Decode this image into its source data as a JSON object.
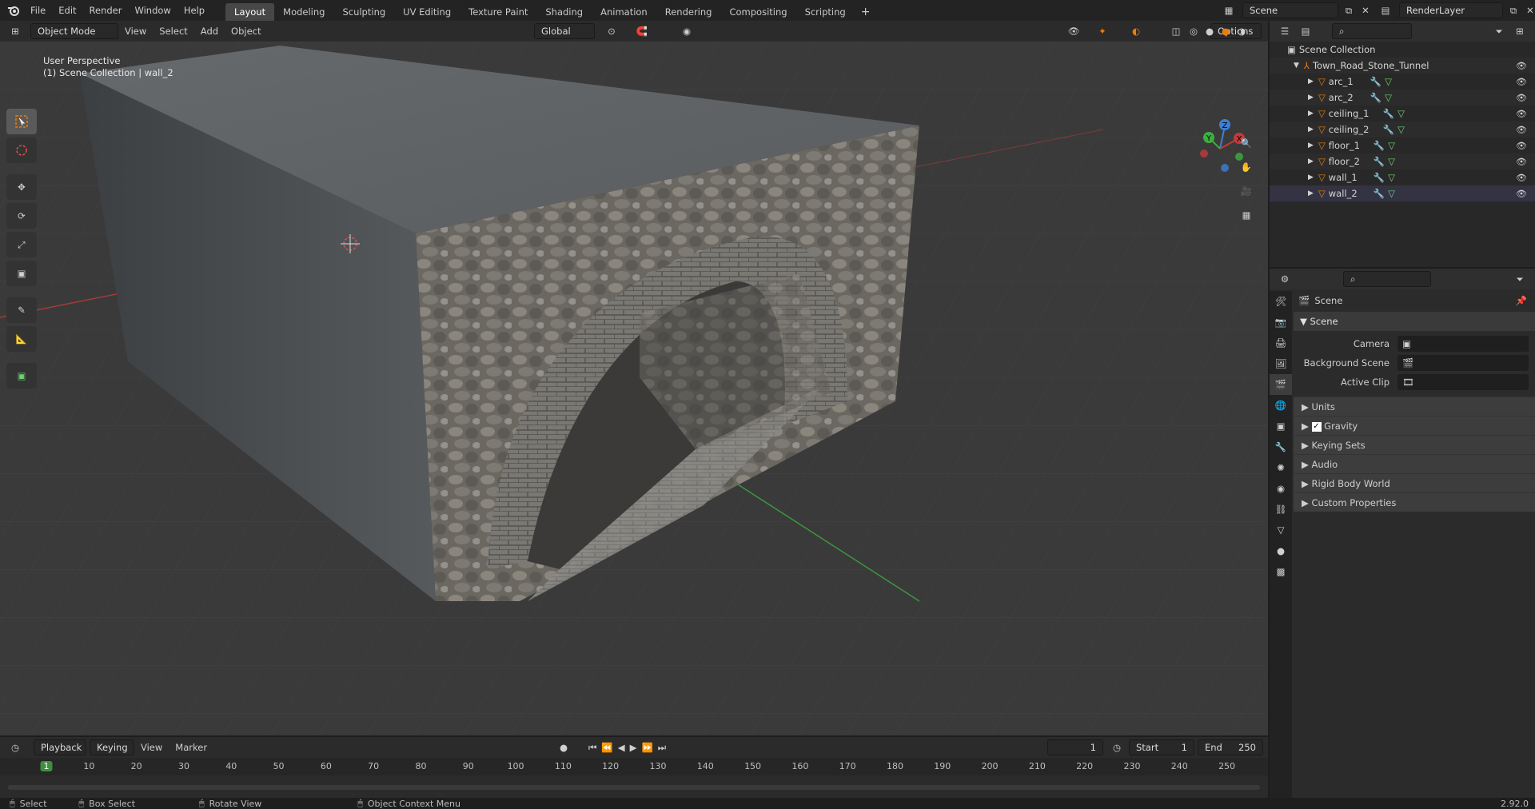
{
  "topbar": {
    "menus": [
      "File",
      "Edit",
      "Render",
      "Window",
      "Help"
    ],
    "workspaces": [
      "Layout",
      "Modeling",
      "Sculpting",
      "UV Editing",
      "Texture Paint",
      "Shading",
      "Animation",
      "Rendering",
      "Compositing",
      "Scripting"
    ],
    "active_workspace": "Layout",
    "add_tab": "+",
    "scene": "Scene",
    "render_layer": "RenderLayer"
  },
  "vpheader": {
    "mode": "Object Mode",
    "menus": [
      "View",
      "Select",
      "Add",
      "Object"
    ],
    "orientation": "Global",
    "options": "Options"
  },
  "viewport": {
    "perspective": "User Perspective",
    "context": "(1) Scene Collection | wall_2",
    "gizmo_axes": [
      "Z",
      "Y",
      "X"
    ]
  },
  "outliner": {
    "root": "Scene Collection",
    "collection": "Town_Road_Stone_Tunnel",
    "objects": [
      "arc_1",
      "arc_2",
      "ceiling_1",
      "ceiling_2",
      "floor_1",
      "floor_2",
      "wall_1",
      "wall_2"
    ]
  },
  "properties": {
    "context": "Scene",
    "panel": "Scene",
    "fields": [
      {
        "label": "Camera",
        "value": ""
      },
      {
        "label": "Background Scene",
        "value": ""
      },
      {
        "label": "Active Clip",
        "value": ""
      }
    ],
    "subpanels": [
      "Units",
      "Gravity",
      "Keying Sets",
      "Audio",
      "Rigid Body World",
      "Custom Properties"
    ],
    "gravity_checked": true
  },
  "timeline": {
    "menus": [
      "Playback",
      "Keying",
      "View",
      "Marker"
    ],
    "current_frame": "1",
    "start_label": "Start",
    "start": "1",
    "end_label": "End",
    "end": "250",
    "ticks": [
      "1",
      "10",
      "20",
      "30",
      "40",
      "50",
      "60",
      "70",
      "80",
      "90",
      "100",
      "110",
      "120",
      "130",
      "140",
      "150",
      "160",
      "170",
      "180",
      "190",
      "200",
      "210",
      "220",
      "230",
      "240",
      "250"
    ]
  },
  "statusbar": {
    "items": [
      "Select",
      "Box Select",
      "Rotate View",
      "Object Context Menu"
    ],
    "version": "2.92.0"
  },
  "colors": {
    "accent": "#e87d0d",
    "active_tab": "#474747",
    "viewport_bg": "#3a3a3a",
    "x_axis": "#c23b3b",
    "y_axis": "#3fae3f",
    "z_axis": "#3d7fd6"
  }
}
